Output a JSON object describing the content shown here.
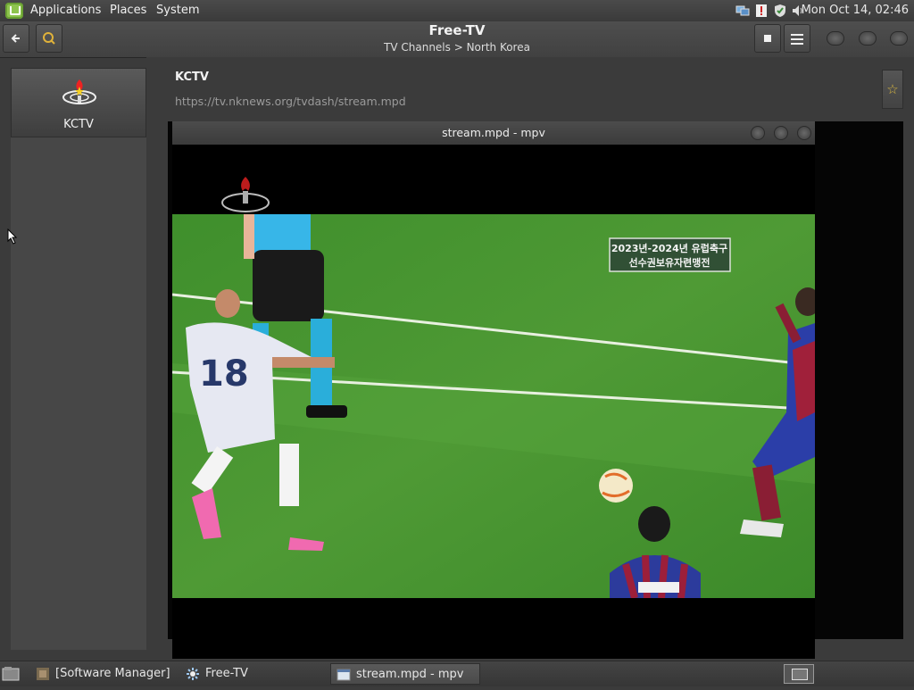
{
  "top_panel": {
    "menu_applications": "Applications",
    "menu_places": "Places",
    "menu_system": "System",
    "clock": "Mon Oct 14, 02:46",
    "tray_icons": [
      "network-icon",
      "update-icon",
      "shield-icon",
      "volume-icon"
    ]
  },
  "app": {
    "title": "Free-TV",
    "subtitle": "TV Channels > North Korea",
    "back_icon": "back-arrow-icon",
    "search_icon": "search-icon",
    "stop_icon": "stop-icon",
    "menu_icon": "hamburger-menu-icon"
  },
  "sidebar": {
    "channels": [
      {
        "name": "KCTV",
        "logo": "kctv-logo"
      }
    ]
  },
  "channel": {
    "title": "KCTV",
    "url": "https://tv.nknews.org/tvdash/stream.mpd",
    "favorite_icon": "star-icon"
  },
  "mpv_window": {
    "title": "stream.mpd - mpv",
    "overlay_line1": "2023년-2024년 유럽축구",
    "overlay_line2": "선수권보유자련맹전",
    "jersey_number": "18"
  },
  "taskbar": {
    "items": [
      {
        "label": "[Software Manager]",
        "icon": "software-manager-icon",
        "active": false
      },
      {
        "label": "Free-TV",
        "icon": "free-tv-icon",
        "active": false
      },
      {
        "label": "stream.mpd - mpv",
        "icon": "mpv-icon",
        "active": true
      }
    ]
  },
  "colors": {
    "mint_green": "#8ec44e",
    "pitch_green": "#4f9a35",
    "star_gold": "#d8b640"
  }
}
